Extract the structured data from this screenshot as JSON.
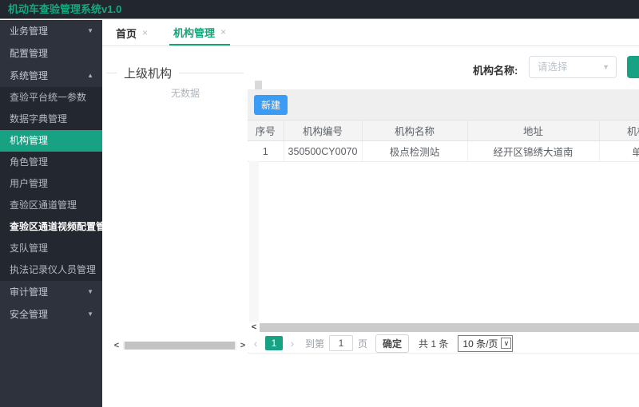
{
  "app": {
    "title": "机动车查验管理系统v1.0"
  },
  "colors": {
    "accent_teal": "#17a283",
    "header_bg": "#22262e",
    "sidebar_bg": "#2d323d",
    "submenu_bg": "#23272f",
    "new_button_blue": "#3b9cf5",
    "table_header_bg": "#f4f4f5"
  },
  "icons": {
    "chevron_down": "▼",
    "chevron_up": "▲",
    "close": "×",
    "select_caret": "▼",
    "scroll_left": "<",
    "scroll_right": ">",
    "page_prev": "‹",
    "page_next": "›",
    "native_caret": "∨"
  },
  "sidebar": {
    "top": [
      {
        "label": "业务管理"
      },
      {
        "label": "配置管理"
      },
      {
        "label": "系统管理"
      }
    ],
    "submenu": [
      "查验平台统一参数",
      "数据字典管理",
      "机构管理",
      "角色管理",
      "用户管理",
      "查验区通道管理",
      "查验区通道视频配置管理",
      "支队管理",
      "执法记录仪人员管理"
    ],
    "active_item": "机构管理",
    "bottom": [
      {
        "label": "审计管理"
      },
      {
        "label": "安全管理"
      }
    ]
  },
  "tabs": [
    {
      "label": "首页"
    },
    {
      "label": "机构管理",
      "active": true
    }
  ],
  "tree_panel": {
    "legend": "上级机构",
    "empty_text": "无数据"
  },
  "search": {
    "label": "机构名称:",
    "placeholder": "请选择"
  },
  "toolbar": {
    "new_button": "新建"
  },
  "table": {
    "columns": [
      "序号",
      "机构编号",
      "机构名称",
      "地址",
      "机构"
    ],
    "rows": [
      [
        "1",
        "350500CY0070",
        "极点检测站",
        "经开区锦绣大道南",
        "单"
      ]
    ]
  },
  "pagination": {
    "page": "1",
    "goto_label": "到第",
    "goto_value": "1",
    "page_word": "页",
    "confirm": "确定",
    "total": "共 1 条",
    "page_size": "10 条/页"
  }
}
